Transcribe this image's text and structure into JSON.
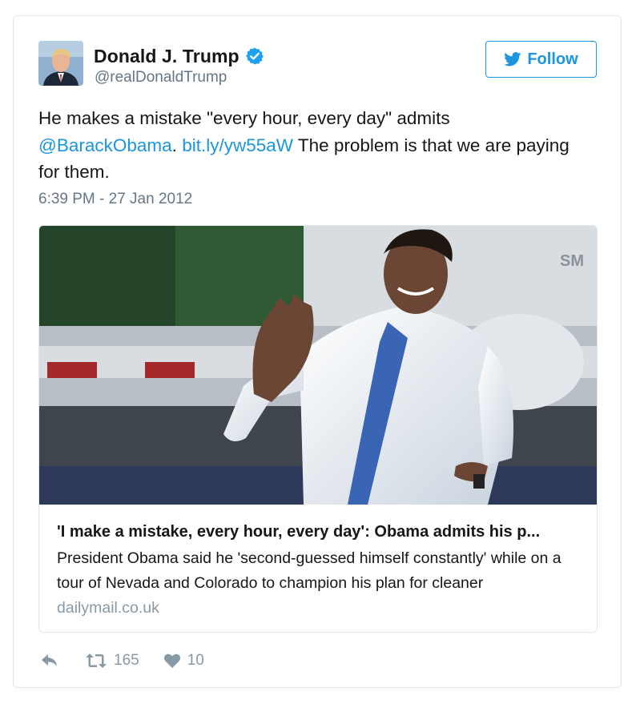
{
  "user": {
    "display_name": "Donald J. Trump",
    "screen_name": "@realDonaldTrump",
    "verified": true
  },
  "follow_button": {
    "label": "Follow"
  },
  "tweet": {
    "text_part1": "He makes a mistake \"every hour, every day\" admits",
    "mention": "@BarackObama",
    "text_part2": ".",
    "link": "bit.ly/yw55aW",
    "text_part3": " The problem is that we are paying for them.",
    "timestamp": "6:39 PM - 27 Jan 2012"
  },
  "link_card": {
    "title": "'I make a mistake, every hour, every day': Obama admits his p...",
    "description": "President Obama said he 'second-guessed himself constantly' while on a tour of Nevada and Colorado to champion his plan for cleaner",
    "domain": "dailymail.co.uk"
  },
  "actions": {
    "reply_icon": "reply-icon",
    "retweet_count": "165",
    "like_count": "10"
  },
  "colors": {
    "accent": "#1b95e0",
    "muted": "#657786",
    "border": "#e1e8ed"
  }
}
